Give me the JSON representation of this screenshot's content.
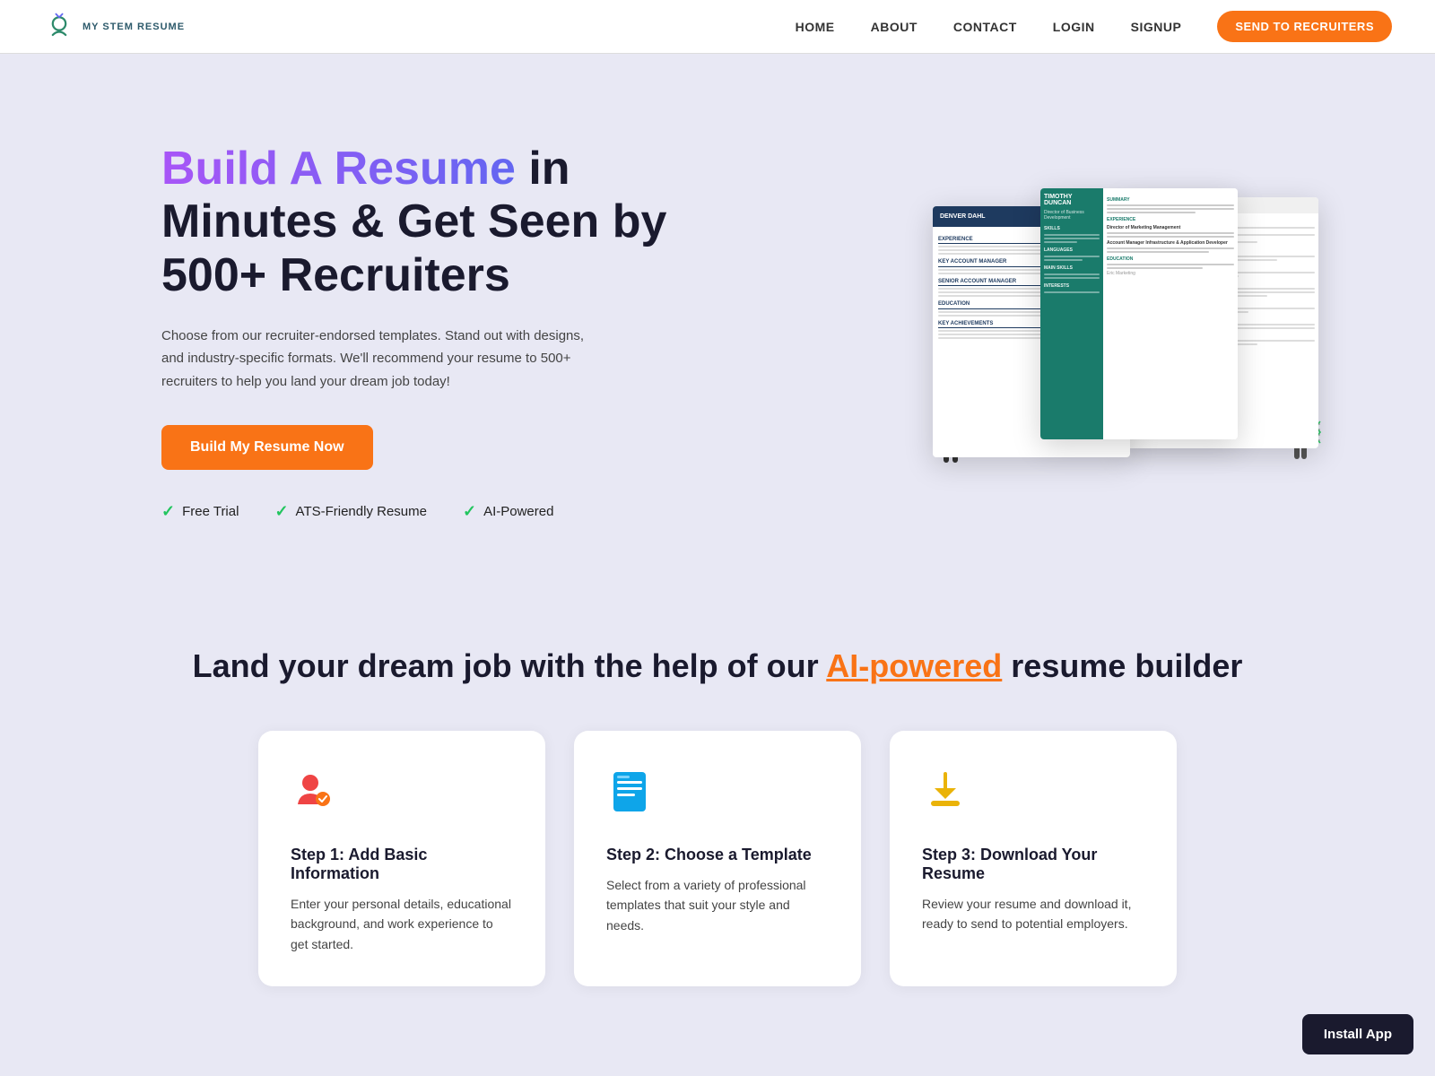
{
  "nav": {
    "logo_text": "MY STEM RESUME",
    "links": [
      {
        "label": "HOME",
        "href": "#"
      },
      {
        "label": "ABOUT",
        "href": "#"
      },
      {
        "label": "CONTACT",
        "href": "#"
      },
      {
        "label": "LOGIN",
        "href": "#"
      },
      {
        "label": "SIGNUP",
        "href": "#"
      }
    ],
    "cta_label": "SEND TO RECRUITERS"
  },
  "hero": {
    "title_plain": " in Minutes & Get Seen by 500+ Recruiters",
    "title_highlight": "Build A Resume",
    "description": "Choose from our recruiter-endorsed templates. Stand out with designs, and industry-specific formats. We'll recommend your resume to 500+ recruiters to help you land your dream job today!",
    "cta_button": "Build My Resume Now",
    "features": [
      {
        "label": "Free Trial"
      },
      {
        "label": "ATS-Friendly Resume"
      },
      {
        "label": "AI-Powered"
      }
    ]
  },
  "section2": {
    "title_plain": "Land your dream job with the help of our ",
    "title_highlight": "AI-powered",
    "title_end": " resume builder",
    "steps": [
      {
        "icon": "👤",
        "icon_color": "#ef4444",
        "title": "Step 1: Add Basic Information",
        "description": "Enter your personal details, educational background, and work experience to get started."
      },
      {
        "icon": "📄",
        "icon_color": "#0ea5e9",
        "title": "Step 2: Choose a Template",
        "description": "Select from a variety of professional templates that suit your style and needs."
      },
      {
        "icon": "⬇️",
        "icon_color": "#eab308",
        "title": "Step 3: Download Your Resume",
        "description": "Review your resume and download it, ready to send to potential employers."
      }
    ]
  },
  "install_app": {
    "label": "Install App"
  }
}
